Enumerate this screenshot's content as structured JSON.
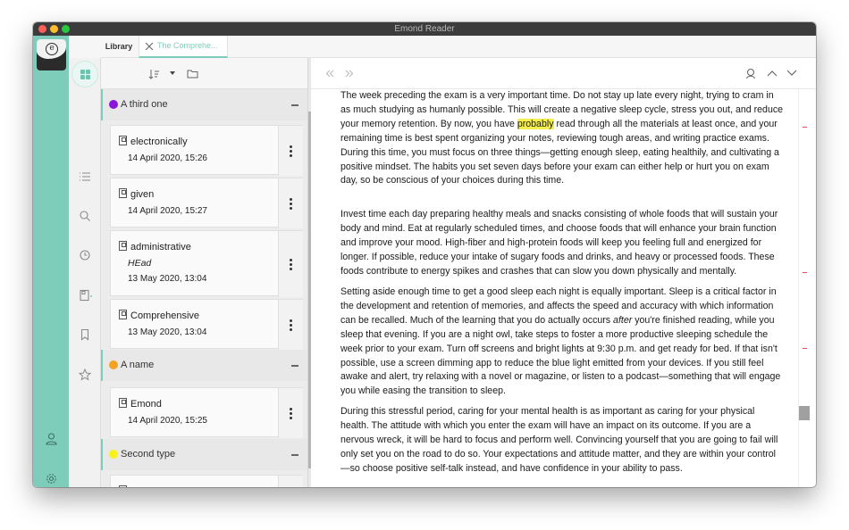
{
  "app": {
    "title": "Emond Reader",
    "logo_letter": "e"
  },
  "tabs": {
    "library": "Library",
    "document": "The Comprehe..."
  },
  "groups": [
    {
      "name": "A third one",
      "color": "#8b16d9"
    },
    {
      "name": "A name",
      "color": "#f4a223"
    },
    {
      "name": "Second type",
      "color": "#f7f21a"
    }
  ],
  "cards": [
    {
      "title": "electronically",
      "date": "14 April 2020, 15:26"
    },
    {
      "title": "given",
      "date": "14 April 2020, 15:27"
    },
    {
      "title": "administrative",
      "subtitle": "HEad",
      "date": "13 May 2020, 13:04"
    },
    {
      "title": "Comprehensive",
      "date": "13 May 2020, 13:04"
    },
    {
      "title": "Emond",
      "date": "14 April 2020, 15:25"
    }
  ],
  "reader": {
    "p1_before": "The week preceding the exam is a very important time. Do not stay up late every night, trying to cram in as much studying as humanly possible. This will create a negative sleep cycle, stress you out, and reduce your memory retention. By now, you have ",
    "p1_highlight": "probably",
    "p1_after": " read through all the materials at least once, and your remaining time is best spent organizing your notes, reviewing tough areas, and writing practice exams. During this time, you must focus on three things—getting enough sleep, eating healthily, and cultivating a positive mindset. The habits you set seven days before your exam can either help or hurt you on exam day, so be conscious of your choices during this time.",
    "p2": "Invest time each day preparing healthy meals and snacks consisting of whole foods that will sustain your body and mind. Eat at regularly scheduled times, and choose foods that will enhance your brain function and improve your mood. High-fiber and high-protein foods will keep you feeling full and energized for longer. If possible, reduce your intake of sugary foods and drinks, and heavy or processed foods. These foods contribute to energy spikes and crashes that can slow you down physically and mentally.",
    "p3_before": "Setting aside enough time to get a good sleep each night is equally important. Sleep is a critical factor in the development and retention of memories, and affects the speed and accuracy with which information can be recalled. Much of the learning that you do actually occurs ",
    "p3_em": "after",
    "p3_after": " you're finished reading, while you sleep that evening. If you are a night owl, take steps to foster a more productive sleeping schedule the week prior to your exam. Turn off screens and bright lights at 9:30 p.m. and get ready for bed. If that isn't possible, use a screen dimming app to reduce the blue light emitted from your devices. If you still feel awake and alert, try relaxing with a novel or magazine, or listen to a podcast—something that will engage you while easing the transition to sleep.",
    "p4": "During this stressful period, caring for your mental health is as important as caring for your physical health. The attitude with which you enter the exam will have an impact on its outcome. If you are a nervous wreck, it will be hard to focus and perform well. Convincing yourself that you are going to fail will only set you on the road to do so. Your expectations and attitude matter, and they are within your control—so choose positive self-talk instead, and have confidence in your ability to pass."
  }
}
